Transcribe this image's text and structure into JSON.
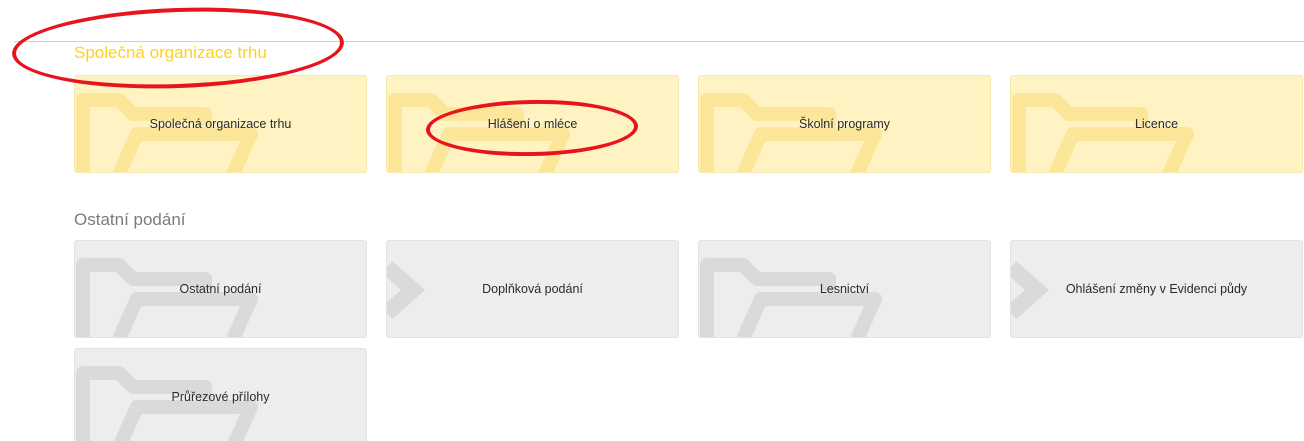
{
  "colors": {
    "section_yellow": "#ffd21a",
    "section_gray": "#7b7b7b",
    "tile_yellow": "#fff3c4",
    "tile_gray": "#ededed",
    "annotation_red": "#e8141d"
  },
  "sections": [
    {
      "title": "Společná organizace trhu",
      "tiles": [
        {
          "label": "Společná organizace trhu",
          "icon": "folder-icon"
        },
        {
          "label": "Hlášení o mléce",
          "icon": "folder-icon"
        },
        {
          "label": "Školní programy",
          "icon": "folder-icon"
        },
        {
          "label": "Licence",
          "icon": "folder-icon"
        }
      ]
    },
    {
      "title": "Ostatní podání",
      "tiles": [
        {
          "label": "Ostatní podání",
          "icon": "folder-icon"
        },
        {
          "label": "Doplňková podání",
          "icon": "arrow-icon"
        },
        {
          "label": "Lesnictví",
          "icon": "folder-icon"
        },
        {
          "label": "Ohlášení změny v Evidenci půdy",
          "icon": "arrow-icon"
        },
        {
          "label": "Průřezové přílohy",
          "icon": "folder-icon"
        }
      ]
    }
  ]
}
